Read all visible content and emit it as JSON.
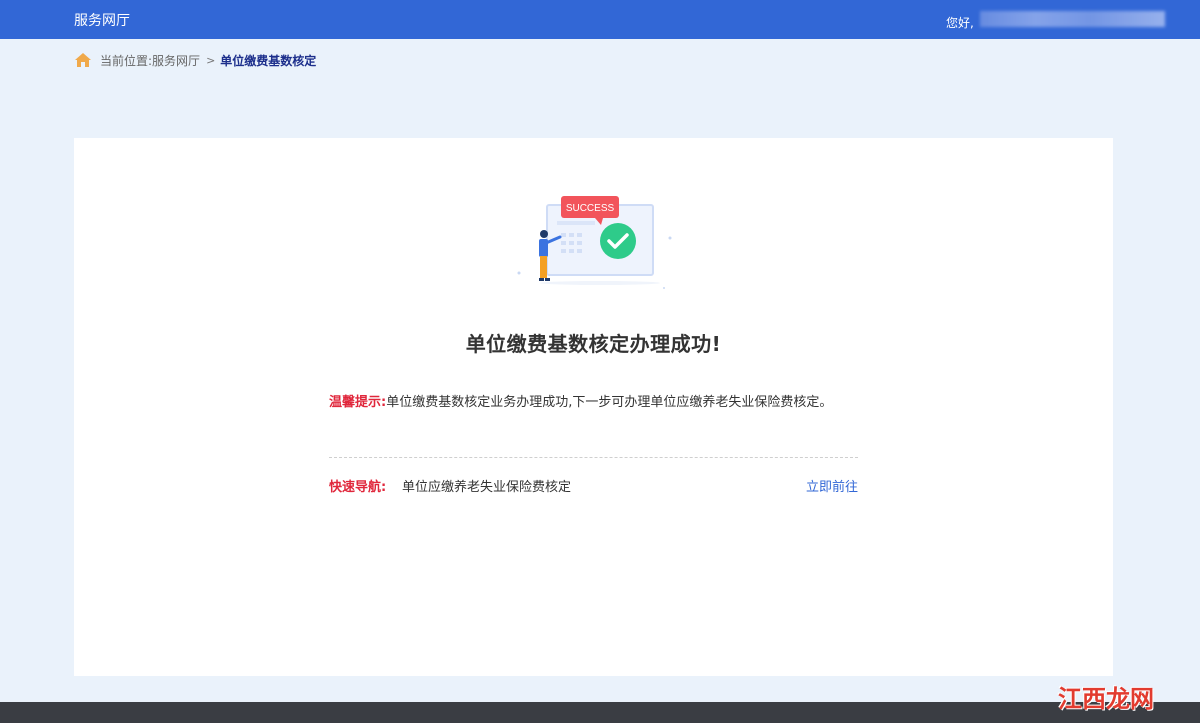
{
  "header": {
    "brand": "服务网厅",
    "greeting": "您好,"
  },
  "breadcrumb": {
    "prefix": "当前位置:",
    "parent": "服务网厅",
    "separator": ">",
    "current": "单位缴费基数核定"
  },
  "result": {
    "badge": "SUCCESS",
    "title": "单位缴费基数核定办理成功!",
    "tip_label": "温馨提示:",
    "tip_text": "单位缴费基数核定业务办理成功,下一步可办理单位应缴养老失业保险费核定。",
    "nav_label": "快速导航:",
    "nav_target": "单位应缴养老失业保险费核定",
    "nav_action": "立即前往"
  },
  "colors": {
    "header_bg": "#3267d6",
    "page_bg": "#eaf2fb",
    "accent_red": "#e0273c",
    "link_blue": "#3267d6",
    "success_green": "#2ecb8a"
  },
  "watermark": "江西龙网"
}
